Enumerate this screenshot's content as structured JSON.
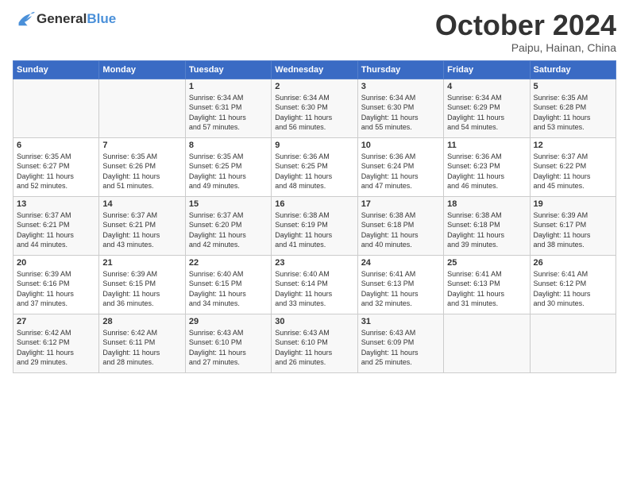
{
  "header": {
    "logo_general": "General",
    "logo_blue": "Blue",
    "month_title": "October 2024",
    "location": "Paipu, Hainan, China"
  },
  "weekdays": [
    "Sunday",
    "Monday",
    "Tuesday",
    "Wednesday",
    "Thursday",
    "Friday",
    "Saturday"
  ],
  "weeks": [
    [
      {
        "day": "",
        "info": ""
      },
      {
        "day": "",
        "info": ""
      },
      {
        "day": "1",
        "info": "Sunrise: 6:34 AM\nSunset: 6:31 PM\nDaylight: 11 hours\nand 57 minutes."
      },
      {
        "day": "2",
        "info": "Sunrise: 6:34 AM\nSunset: 6:30 PM\nDaylight: 11 hours\nand 56 minutes."
      },
      {
        "day": "3",
        "info": "Sunrise: 6:34 AM\nSunset: 6:30 PM\nDaylight: 11 hours\nand 55 minutes."
      },
      {
        "day": "4",
        "info": "Sunrise: 6:34 AM\nSunset: 6:29 PM\nDaylight: 11 hours\nand 54 minutes."
      },
      {
        "day": "5",
        "info": "Sunrise: 6:35 AM\nSunset: 6:28 PM\nDaylight: 11 hours\nand 53 minutes."
      }
    ],
    [
      {
        "day": "6",
        "info": "Sunrise: 6:35 AM\nSunset: 6:27 PM\nDaylight: 11 hours\nand 52 minutes."
      },
      {
        "day": "7",
        "info": "Sunrise: 6:35 AM\nSunset: 6:26 PM\nDaylight: 11 hours\nand 51 minutes."
      },
      {
        "day": "8",
        "info": "Sunrise: 6:35 AM\nSunset: 6:25 PM\nDaylight: 11 hours\nand 49 minutes."
      },
      {
        "day": "9",
        "info": "Sunrise: 6:36 AM\nSunset: 6:25 PM\nDaylight: 11 hours\nand 48 minutes."
      },
      {
        "day": "10",
        "info": "Sunrise: 6:36 AM\nSunset: 6:24 PM\nDaylight: 11 hours\nand 47 minutes."
      },
      {
        "day": "11",
        "info": "Sunrise: 6:36 AM\nSunset: 6:23 PM\nDaylight: 11 hours\nand 46 minutes."
      },
      {
        "day": "12",
        "info": "Sunrise: 6:37 AM\nSunset: 6:22 PM\nDaylight: 11 hours\nand 45 minutes."
      }
    ],
    [
      {
        "day": "13",
        "info": "Sunrise: 6:37 AM\nSunset: 6:21 PM\nDaylight: 11 hours\nand 44 minutes."
      },
      {
        "day": "14",
        "info": "Sunrise: 6:37 AM\nSunset: 6:21 PM\nDaylight: 11 hours\nand 43 minutes."
      },
      {
        "day": "15",
        "info": "Sunrise: 6:37 AM\nSunset: 6:20 PM\nDaylight: 11 hours\nand 42 minutes."
      },
      {
        "day": "16",
        "info": "Sunrise: 6:38 AM\nSunset: 6:19 PM\nDaylight: 11 hours\nand 41 minutes."
      },
      {
        "day": "17",
        "info": "Sunrise: 6:38 AM\nSunset: 6:18 PM\nDaylight: 11 hours\nand 40 minutes."
      },
      {
        "day": "18",
        "info": "Sunrise: 6:38 AM\nSunset: 6:18 PM\nDaylight: 11 hours\nand 39 minutes."
      },
      {
        "day": "19",
        "info": "Sunrise: 6:39 AM\nSunset: 6:17 PM\nDaylight: 11 hours\nand 38 minutes."
      }
    ],
    [
      {
        "day": "20",
        "info": "Sunrise: 6:39 AM\nSunset: 6:16 PM\nDaylight: 11 hours\nand 37 minutes."
      },
      {
        "day": "21",
        "info": "Sunrise: 6:39 AM\nSunset: 6:15 PM\nDaylight: 11 hours\nand 36 minutes."
      },
      {
        "day": "22",
        "info": "Sunrise: 6:40 AM\nSunset: 6:15 PM\nDaylight: 11 hours\nand 34 minutes."
      },
      {
        "day": "23",
        "info": "Sunrise: 6:40 AM\nSunset: 6:14 PM\nDaylight: 11 hours\nand 33 minutes."
      },
      {
        "day": "24",
        "info": "Sunrise: 6:41 AM\nSunset: 6:13 PM\nDaylight: 11 hours\nand 32 minutes."
      },
      {
        "day": "25",
        "info": "Sunrise: 6:41 AM\nSunset: 6:13 PM\nDaylight: 11 hours\nand 31 minutes."
      },
      {
        "day": "26",
        "info": "Sunrise: 6:41 AM\nSunset: 6:12 PM\nDaylight: 11 hours\nand 30 minutes."
      }
    ],
    [
      {
        "day": "27",
        "info": "Sunrise: 6:42 AM\nSunset: 6:12 PM\nDaylight: 11 hours\nand 29 minutes."
      },
      {
        "day": "28",
        "info": "Sunrise: 6:42 AM\nSunset: 6:11 PM\nDaylight: 11 hours\nand 28 minutes."
      },
      {
        "day": "29",
        "info": "Sunrise: 6:43 AM\nSunset: 6:10 PM\nDaylight: 11 hours\nand 27 minutes."
      },
      {
        "day": "30",
        "info": "Sunrise: 6:43 AM\nSunset: 6:10 PM\nDaylight: 11 hours\nand 26 minutes."
      },
      {
        "day": "31",
        "info": "Sunrise: 6:43 AM\nSunset: 6:09 PM\nDaylight: 11 hours\nand 25 minutes."
      },
      {
        "day": "",
        "info": ""
      },
      {
        "day": "",
        "info": ""
      }
    ]
  ]
}
